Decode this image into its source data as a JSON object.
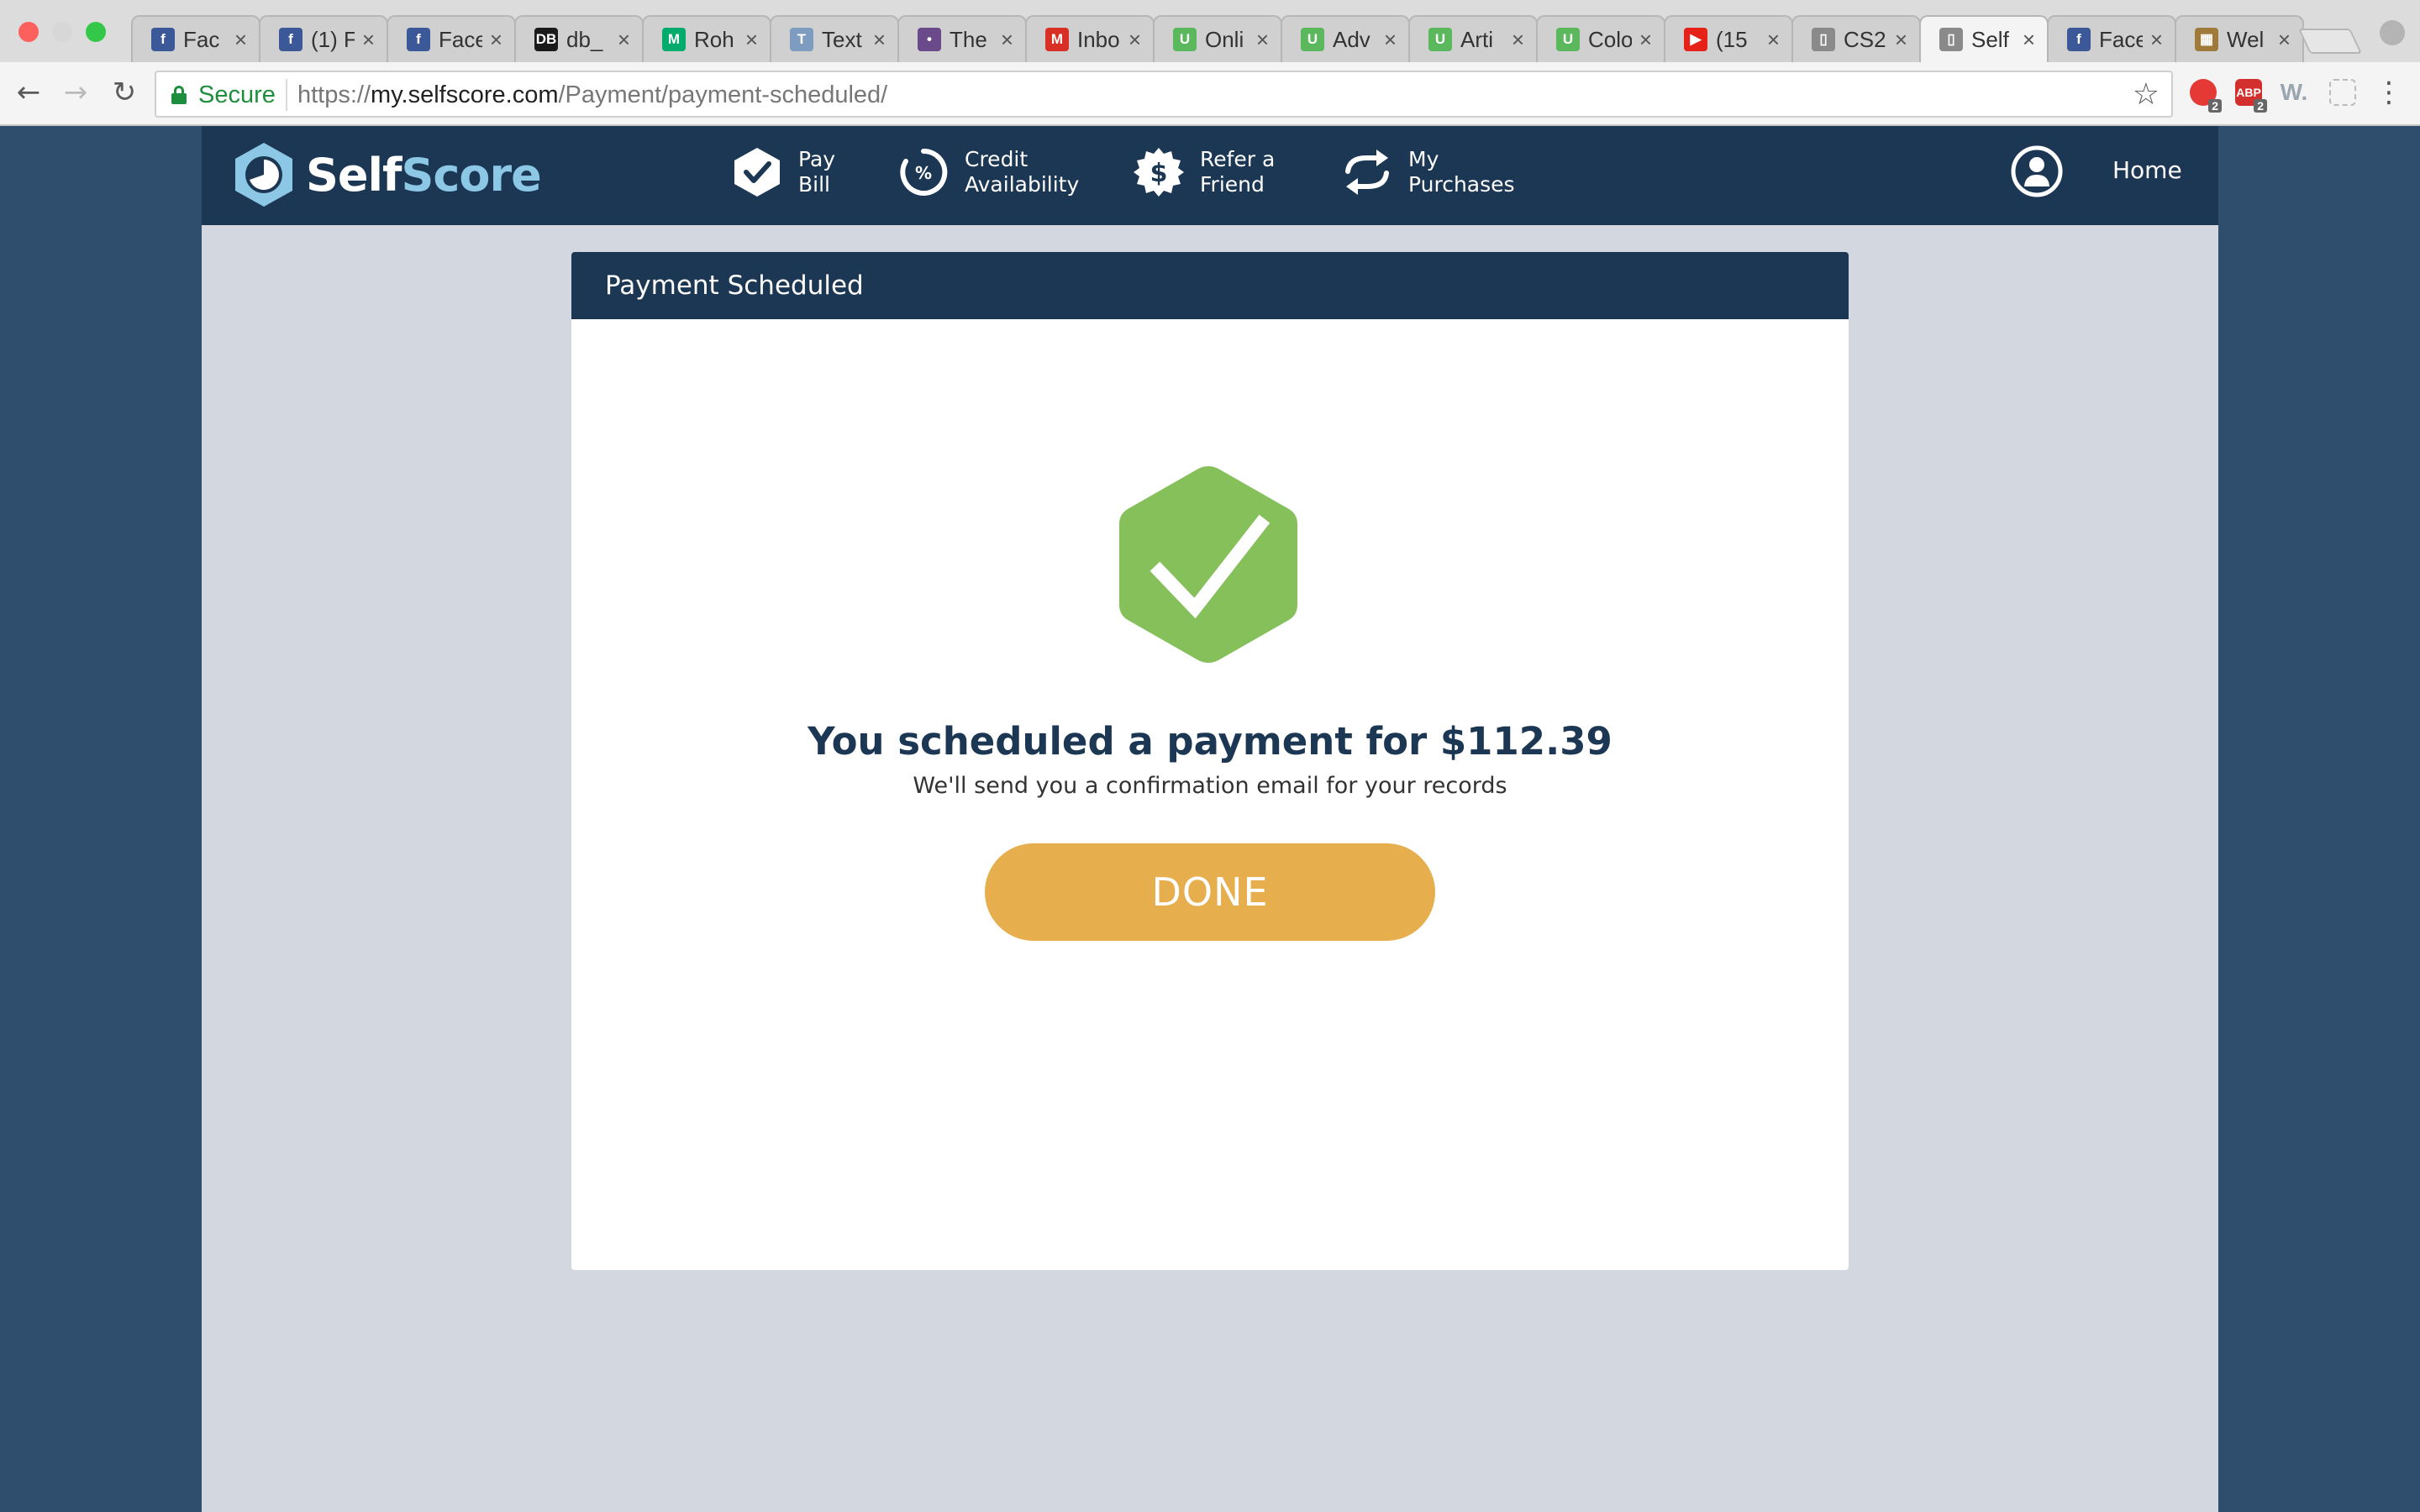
{
  "browser": {
    "tabs": [
      {
        "title": "Fac",
        "favicon": "facebook-icon",
        "color": "#3b5998",
        "glyph": "f"
      },
      {
        "title": "(1) F",
        "favicon": "facebook-icon",
        "color": "#3b5998",
        "glyph": "f"
      },
      {
        "title": "Face",
        "favicon": "facebook-icon",
        "color": "#3b5998",
        "glyph": "f"
      },
      {
        "title": "db_",
        "favicon": "db-icon",
        "color": "#1a1a1a",
        "glyph": "DB"
      },
      {
        "title": "Roh",
        "favicon": "medium-icon",
        "color": "#00ab6c",
        "glyph": "M"
      },
      {
        "title": "Text",
        "favicon": "text-icon",
        "color": "#7d9cc0",
        "glyph": "T"
      },
      {
        "title": "The",
        "favicon": "avatar-icon",
        "color": "#6a4a8a",
        "glyph": "•"
      },
      {
        "title": "Inbo",
        "favicon": "gmail-icon",
        "color": "#d93025",
        "glyph": "M"
      },
      {
        "title": "Onli",
        "favicon": "upwork-icon",
        "color": "#5cb85c",
        "glyph": "U"
      },
      {
        "title": "Adv",
        "favicon": "upwork-icon",
        "color": "#5cb85c",
        "glyph": "U"
      },
      {
        "title": "Arti",
        "favicon": "upwork-icon",
        "color": "#5cb85c",
        "glyph": "U"
      },
      {
        "title": "Colo",
        "favicon": "upwork-icon",
        "color": "#5cb85c",
        "glyph": "U"
      },
      {
        "title": "(15",
        "favicon": "youtube-icon",
        "color": "#e62117",
        "glyph": "▶"
      },
      {
        "title": "CS2",
        "favicon": "document-icon",
        "color": "#8a8a8a",
        "glyph": "▯"
      },
      {
        "title": "Self",
        "favicon": "document-icon",
        "color": "#8a8a8a",
        "glyph": "▯",
        "active": true
      },
      {
        "title": "Face",
        "favicon": "facebook-icon",
        "color": "#3b5998",
        "glyph": "f"
      },
      {
        "title": "Wel",
        "favicon": "app-icon",
        "color": "#a07a3a",
        "glyph": "▦"
      }
    ],
    "secure_label": "Secure",
    "url_scheme": "https://",
    "url_host": "my.selfscore.com",
    "url_path": "/Payment/payment-scheduled/",
    "ext_badge_1": "2",
    "ext_badge_2": "2",
    "ext_abp_label": "ABP",
    "ext_w_label": "W."
  },
  "site": {
    "logo_self": "Self",
    "logo_score": "Score",
    "nav": {
      "pay_bill": "Pay\nBill",
      "credit_availability": "Credit\nAvailability",
      "refer_friend": "Refer a\nFriend",
      "my_purchases": "My\nPurchases",
      "home": "Home"
    },
    "colors": {
      "header": "#1c3753",
      "accent": "#8cc7e6",
      "success": "#86c05b",
      "button": "#e6ae4c",
      "background": "#d3d8e0"
    }
  },
  "card": {
    "title": "Payment Scheduled",
    "headline": "You scheduled a payment for $112.39",
    "subline": "We'll send you a confirmation email for your records",
    "done_label": "DONE"
  }
}
